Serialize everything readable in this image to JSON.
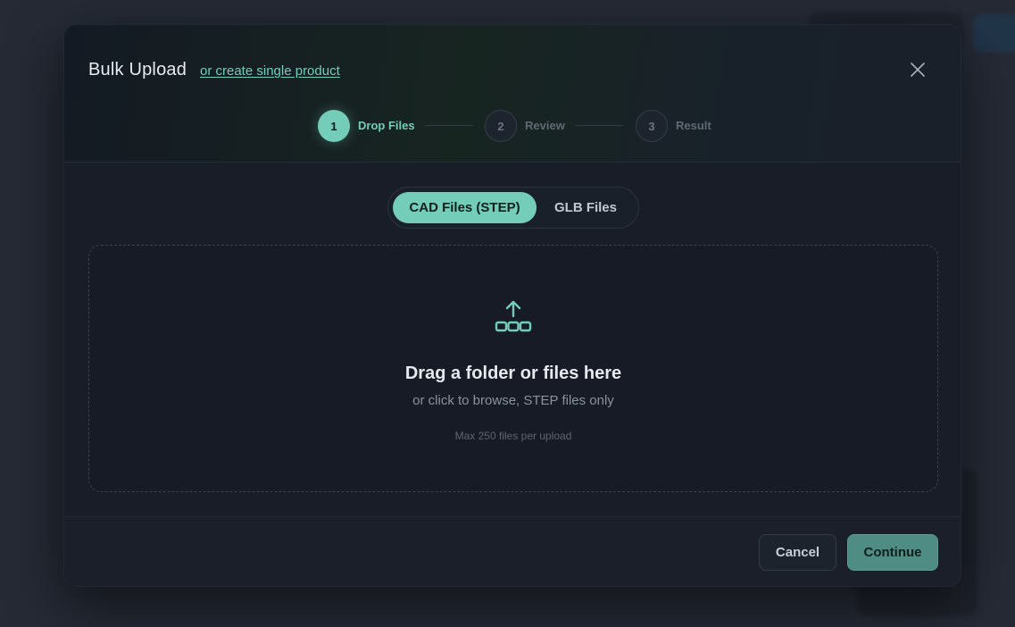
{
  "modal": {
    "title": "Bulk Upload",
    "single_link": "or create single product",
    "close_icon": "close-icon"
  },
  "stepper": {
    "steps": [
      {
        "number": "1",
        "label": "Drop Files",
        "state": "active"
      },
      {
        "number": "2",
        "label": "Review",
        "state": "inactive"
      },
      {
        "number": "3",
        "label": "Result",
        "state": "inactive"
      }
    ]
  },
  "file_type_toggle": {
    "options": [
      {
        "label": "CAD Files (STEP)",
        "selected": true
      },
      {
        "label": "GLB Files",
        "selected": false
      }
    ]
  },
  "dropzone": {
    "icon": "upload-folder-icon",
    "title": "Drag a folder or files here",
    "subtitle": "or click to browse, STEP files only",
    "limit": "Max 250 files per upload"
  },
  "footer": {
    "cancel_label": "Cancel",
    "continue_label": "Continue"
  },
  "colors": {
    "accent": "#74cdb8",
    "modal_bg": "#181d27",
    "continue_bg": "#4f8c84"
  }
}
